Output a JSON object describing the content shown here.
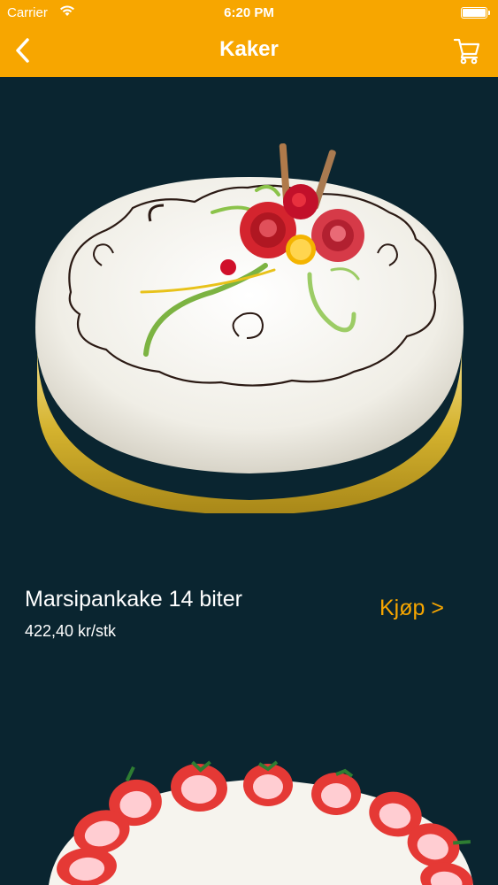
{
  "status_bar": {
    "carrier": "Carrier",
    "time": "6:20 PM",
    "wifi_icon": "wifi-icon",
    "battery_icon": "battery-icon"
  },
  "nav": {
    "title": "Kaker",
    "back_icon": "chevron-left-icon",
    "cart_icon": "shopping-cart-icon",
    "background_color": "#f7a600"
  },
  "products": [
    {
      "name": "Marsipankake 14 biter",
      "price": "422,40 kr/stk",
      "buy_label": "Kjøp >"
    }
  ],
  "colors": {
    "accent": "#f7a600",
    "background": "#0a2530",
    "text": "#ffffff"
  }
}
